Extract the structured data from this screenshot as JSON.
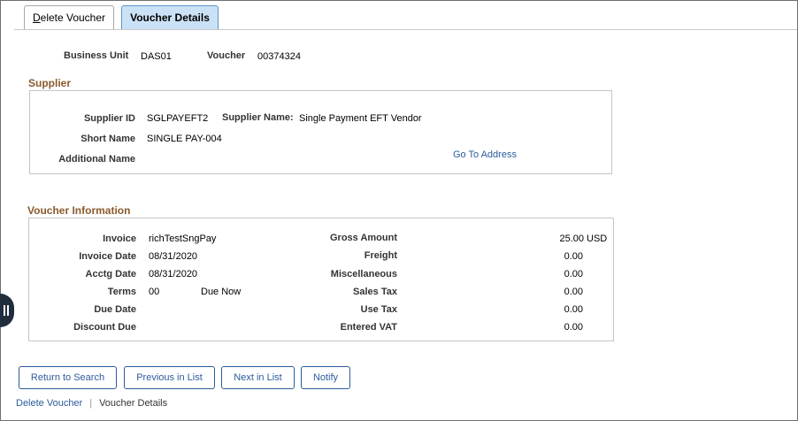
{
  "tabs": {
    "delete_voucher_prefix": "D",
    "delete_voucher_rest": "elete Voucher",
    "voucher_details": "Voucher Details"
  },
  "header": {
    "business_unit_label": "Business Unit",
    "business_unit_value": "DAS01",
    "voucher_label": "Voucher",
    "voucher_value": "00374324"
  },
  "supplier": {
    "title": "Supplier",
    "supplier_id_label": "Supplier ID",
    "supplier_id_value": "SGLPAYEFT2",
    "supplier_name_label": "Supplier Name:",
    "supplier_name_value": "Single Payment EFT Vendor",
    "short_name_label": "Short Name",
    "short_name_value": "SINGLE PAY-004",
    "additional_name_label": "Additional Name",
    "go_to_address": "Go To Address"
  },
  "voucher_info": {
    "title": "Voucher Information",
    "invoice_label": "Invoice",
    "invoice_value": "richTestSngPay",
    "invoice_date_label": "Invoice Date",
    "invoice_date_value": "08/31/2020",
    "acctg_date_label": "Acctg Date",
    "acctg_date_value": "08/31/2020",
    "terms_label": "Terms",
    "terms_value": "00",
    "terms_desc": "Due Now",
    "due_date_label": "Due Date",
    "discount_due_label": "Discount Due",
    "gross_amount_label": "Gross Amount",
    "gross_amount_value": "25.00",
    "currency": "USD",
    "freight_label": "Freight",
    "freight_value": "0.00",
    "misc_label": "Miscellaneous",
    "misc_value": "0.00",
    "sales_tax_label": "Sales Tax",
    "sales_tax_value": "0.00",
    "use_tax_label": "Use Tax",
    "use_tax_value": "0.00",
    "entered_vat_label": "Entered VAT",
    "entered_vat_value": "0.00"
  },
  "buttons": {
    "return_to_search": "Return to Search",
    "previous_in_list": "Previous in List",
    "next_in_list": "Next in List",
    "notify": "Notify"
  },
  "bottom_nav": {
    "delete_voucher": "Delete Voucher",
    "separator": "|",
    "voucher_details": "Voucher Details"
  },
  "colors": {
    "section_title": "#8a5a2b",
    "link": "#2c5b9c",
    "active_tab_bg": "#cbe1f5"
  }
}
